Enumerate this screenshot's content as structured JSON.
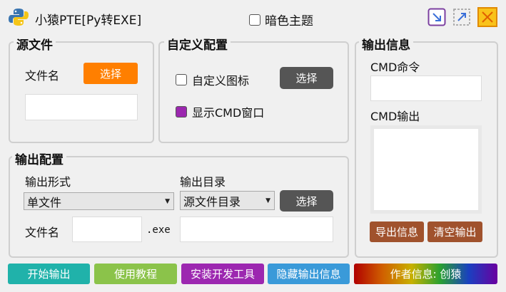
{
  "app": {
    "title": "小猿PTE[Py转EXE]",
    "dark_theme_label": "暗色主题"
  },
  "source": {
    "group_label": "源文件",
    "filename_label": "文件名",
    "select_label": "选择",
    "filename_value": ""
  },
  "custom": {
    "group_label": "自定义配置",
    "custom_icon_label": "自定义图标",
    "custom_icon_checked": false,
    "select_label": "选择",
    "show_cmd_label": "显示CMD窗口",
    "show_cmd_checked": true
  },
  "output_config": {
    "group_label": "输出配置",
    "form_label": "输出形式",
    "form_selected": "单文件",
    "dir_label": "输出目录",
    "dir_selected": "源文件目录",
    "select_label": "选择",
    "filename_label": "文件名",
    "ext_label": ".exe",
    "filename_value": "",
    "dir_value": ""
  },
  "output_info": {
    "group_label": "输出信息",
    "cmd_label": "CMD命令",
    "cmd_value": "",
    "cmd_output_label": "CMD输出",
    "export_label": "导出信息",
    "clear_label": "清空输出"
  },
  "bottom": {
    "start": "开始输出",
    "tutorial": "使用教程",
    "install": "安装开发工具",
    "hide": "隐藏输出信息",
    "author": "作者信息: 创猿"
  },
  "colors": {
    "orange": "#ff7f00",
    "dark_btn": "#555555",
    "purple_check": "#9b27af",
    "brown_btn": "#a0522d",
    "start": "#20b2aa",
    "tutorial": "#8bc34a",
    "install": "#9c27b0",
    "hide": "#3a9ad9"
  }
}
